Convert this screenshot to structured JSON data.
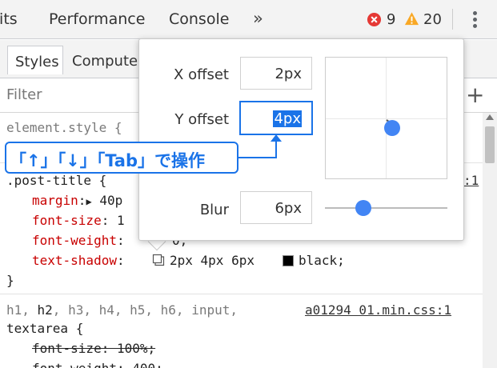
{
  "colors": {
    "accent": "#1a73e8",
    "property": "#c80000",
    "error": "#e53935",
    "warning": "#f9a825"
  },
  "topbar": {
    "tabs": [
      "dits",
      "Performance",
      "Console"
    ],
    "more_tabs": "»",
    "error_count": "9",
    "warning_count": "20"
  },
  "subtabs": {
    "styles": "Styles",
    "computed": "Compute"
  },
  "filter": {
    "placeholder": "Filter",
    "add": "+"
  },
  "code": {
    "element_style": "element.style {",
    "selector": ".post-title {",
    "props": {
      "margin_name": "margin",
      "margin_value": "40p",
      "font_size_name": "font-size",
      "font_size_value": "1",
      "font_weight_name": "font-weight",
      "font_weight_value": "0;",
      "text_shadow_name": "text-shadow",
      "text_shadow_value": "2px 4px 6px",
      "text_shadow_color": "black;"
    },
    "close_brace": "}",
    "source_1": ":1",
    "rule2_selector_a": "h1, ",
    "rule2_selector_b": "h2",
    "rule2_selector_c": ", h3, h4, h5, h6, input,",
    "rule2_source": "a01294 01.min.css:1",
    "rule2_selector_d": "textarea {",
    "rule2_prop1": "font-size: 100%;",
    "rule2_prop2": "font-weight: 400;"
  },
  "shadow_editor": {
    "x_label": "X offset",
    "x_value": "2px",
    "y_label": "Y offset",
    "y_value": "4px",
    "blur_label": "Blur",
    "blur_value": "6px"
  },
  "callout": {
    "text": "「↑」「↓」「Tab」で操作"
  },
  "icons": {
    "more": "double-chevron-right-icon",
    "error": "error-icon",
    "warning": "warning-icon",
    "menu": "kebab-menu-icon"
  }
}
